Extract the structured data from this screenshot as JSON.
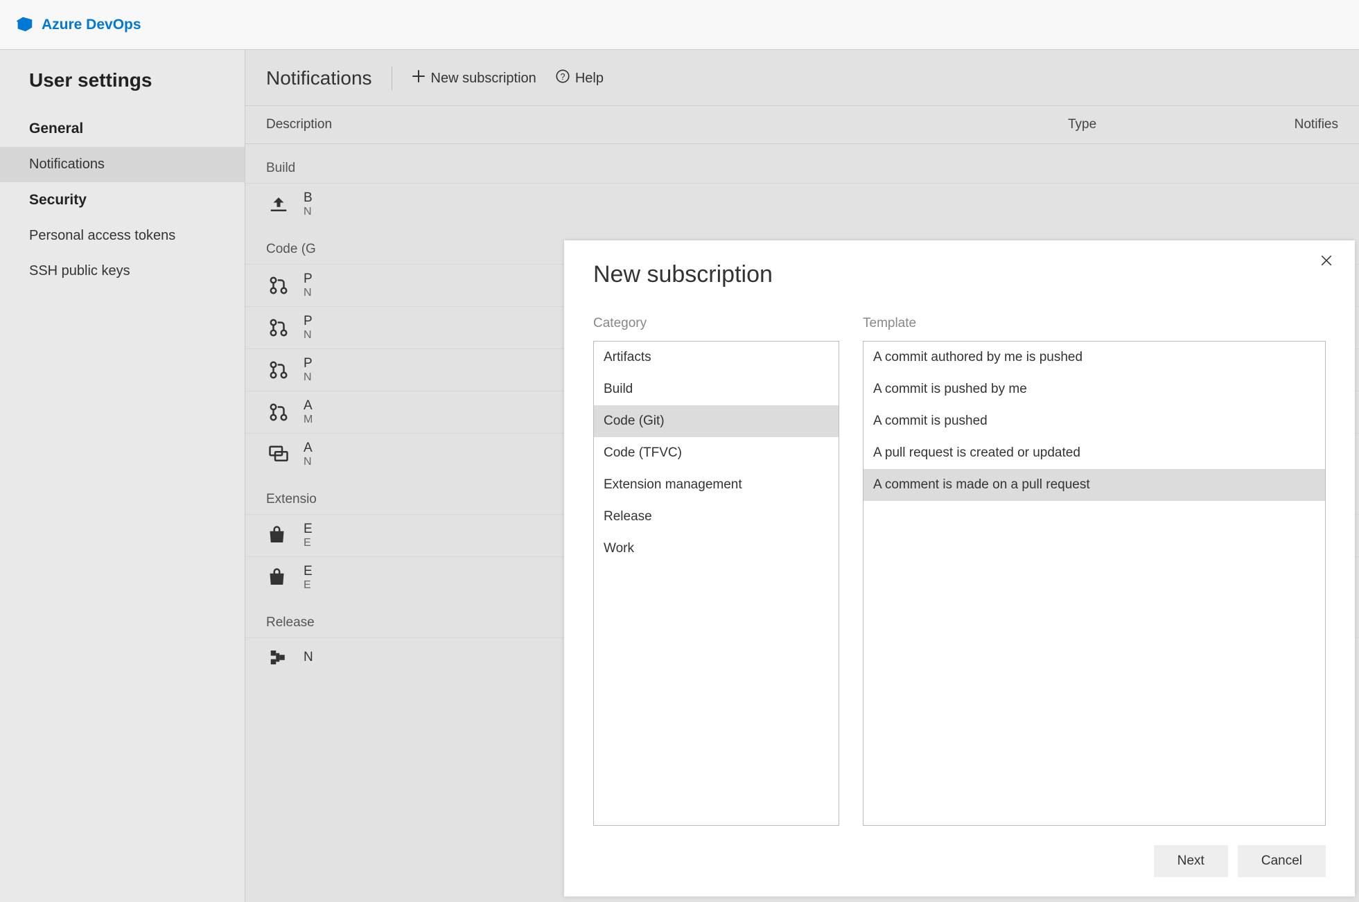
{
  "brand": "Azure DevOps",
  "sidebar": {
    "title": "User settings",
    "sections": [
      {
        "heading": "General",
        "items": [
          {
            "label": "Notifications",
            "active": true
          }
        ]
      },
      {
        "heading": "Security",
        "items": [
          {
            "label": "Personal access tokens",
            "active": false
          },
          {
            "label": "SSH public keys",
            "active": false
          }
        ]
      }
    ]
  },
  "header": {
    "title": "Notifications",
    "new_subscription": "New subscription",
    "help": "Help"
  },
  "table": {
    "columns": {
      "description": "Description",
      "type": "Type",
      "notifies": "Notifies"
    }
  },
  "groups": [
    {
      "label": "Build",
      "rows": [
        {
          "icon": "build",
          "title": "B",
          "sub": "N"
        }
      ]
    },
    {
      "label": "Code (G",
      "rows": [
        {
          "icon": "pr",
          "title": "P",
          "sub": "N"
        },
        {
          "icon": "pr",
          "title": "P",
          "sub": "N"
        },
        {
          "icon": "pr",
          "title": "P",
          "sub": "N"
        },
        {
          "icon": "pr",
          "title": "A",
          "sub": "M"
        },
        {
          "icon": "chat",
          "title": "A",
          "sub": "N"
        }
      ]
    },
    {
      "label": "Extensio",
      "rows": [
        {
          "icon": "bag",
          "title": "E",
          "sub": "E"
        },
        {
          "icon": "bag",
          "title": "E",
          "sub": "E"
        }
      ]
    },
    {
      "label": "Release",
      "rows": [
        {
          "icon": "release",
          "title": "N",
          "sub": ""
        }
      ]
    }
  ],
  "modal": {
    "title": "New subscription",
    "category_label": "Category",
    "template_label": "Template",
    "categories": [
      {
        "label": "Artifacts",
        "selected": false
      },
      {
        "label": "Build",
        "selected": false
      },
      {
        "label": "Code (Git)",
        "selected": true
      },
      {
        "label": "Code (TFVC)",
        "selected": false
      },
      {
        "label": "Extension management",
        "selected": false
      },
      {
        "label": "Release",
        "selected": false
      },
      {
        "label": "Work",
        "selected": false
      }
    ],
    "templates": [
      {
        "label": "A commit authored by me is pushed",
        "selected": false
      },
      {
        "label": "A commit is pushed by me",
        "selected": false
      },
      {
        "label": "A commit is pushed",
        "selected": false
      },
      {
        "label": "A pull request is created or updated",
        "selected": false
      },
      {
        "label": "A comment is made on a pull request",
        "selected": true
      }
    ],
    "next": "Next",
    "cancel": "Cancel"
  }
}
